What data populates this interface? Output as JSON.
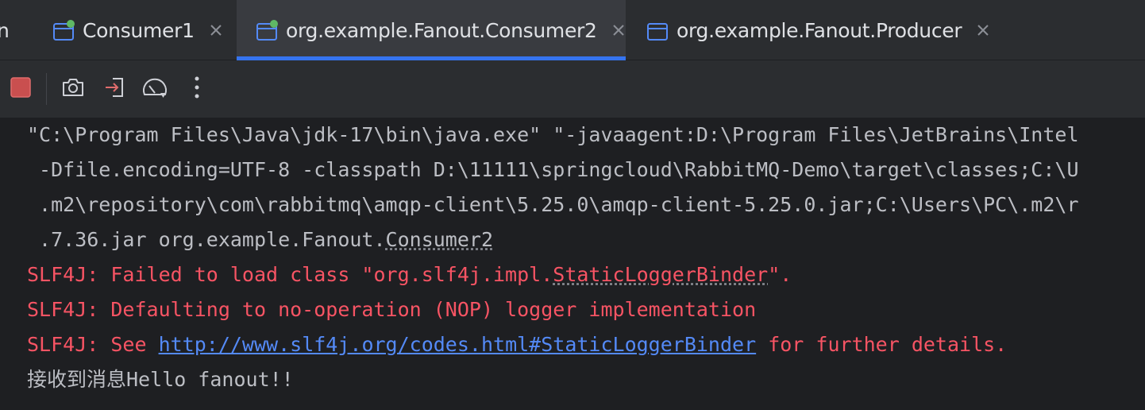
{
  "tabs": [
    {
      "label": "n",
      "partial": true
    },
    {
      "label": "Consumer1",
      "running": true,
      "active": false
    },
    {
      "label": "org.example.Fanout.Consumer2",
      "running": true,
      "active": true
    },
    {
      "label": "org.example.Fanout.Producer",
      "running": false,
      "active": false
    }
  ],
  "toolbar": {
    "icons": [
      "stop-icon",
      "camera-icon",
      "exit-icon",
      "gauge-icon",
      "more-vertical-icon"
    ]
  },
  "console": {
    "command": {
      "line1": "\"C:\\Program Files\\Java\\jdk-17\\bin\\java.exe\" \"-javaagent:D:\\Program Files\\JetBrains\\Intel",
      "line2": " -Dfile.encoding=UTF-8 -classpath D:\\11111\\springcloud\\RabbitMQ-Demo\\target\\classes;C:\\U",
      "line3": " .m2\\repository\\com\\rabbitmq\\amqp-client\\5.25.0\\amqp-client-5.25.0.jar;C:\\Users\\PC\\.m2\\r",
      "line4_prefix": " .7.36.jar org.example.Fanout.",
      "line4_class": "Consumer2"
    },
    "slf4j_1": {
      "prefix": "SLF4J: Failed to load class \"org.slf4j.impl.",
      "class_name": "StaticLoggerBinder",
      "suffix": "\"."
    },
    "slf4j_2": "SLF4J: Defaulting to no-operation (NOP) logger implementation",
    "slf4j_3": {
      "prefix": "SLF4J: See ",
      "link": "http://www.slf4j.org/codes.html#StaticLoggerBinder",
      "suffix": " for further details."
    },
    "output": "接收到消息Hello fanout!!"
  },
  "colors": {
    "background": "#1e1f22",
    "panel": "#2b2d30",
    "active_tab": "#393b40",
    "accent": "#3574f0",
    "running_dot": "#5fb865",
    "error_text": "#f75464",
    "link": "#548af7",
    "stop_fill": "#c94f4f"
  }
}
